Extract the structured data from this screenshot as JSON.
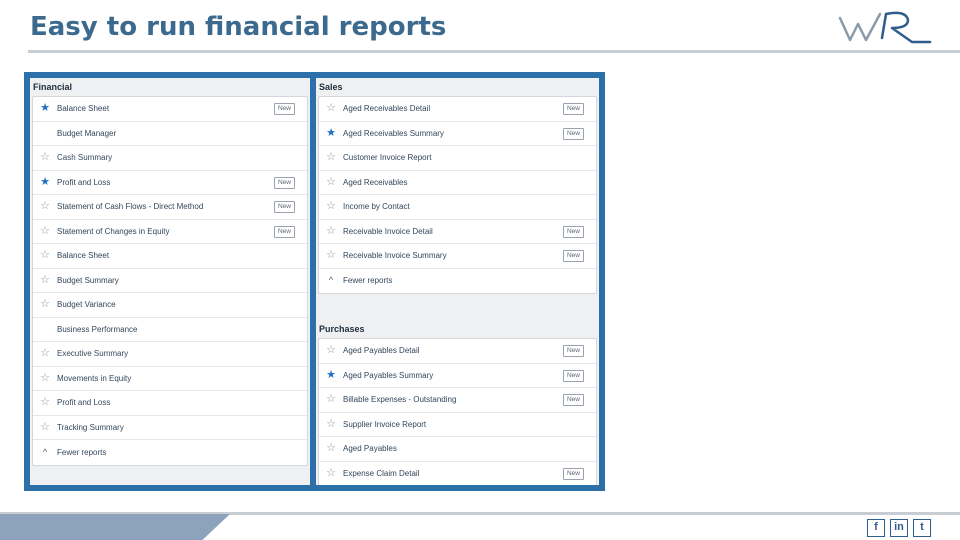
{
  "slide": {
    "title": "Easy to run financial reports"
  },
  "financial": {
    "heading": "Financial",
    "rows": [
      {
        "label": "Balance Sheet",
        "star": "filled",
        "new": "New"
      },
      {
        "label": "Budget Manager",
        "star": "none",
        "new": ""
      },
      {
        "label": "Cash Summary",
        "star": "outline",
        "new": ""
      },
      {
        "label": "Profit and Loss",
        "star": "filled",
        "new": "New"
      },
      {
        "label": "Statement of Cash Flows - Direct Method",
        "star": "outline",
        "new": "New"
      },
      {
        "label": "Statement of Changes in Equity",
        "star": "outline",
        "new": "New"
      },
      {
        "label": "Balance Sheet",
        "star": "outline",
        "new": ""
      },
      {
        "label": "Budget Summary",
        "star": "outline",
        "new": ""
      },
      {
        "label": "Budget Variance",
        "star": "outline",
        "new": ""
      },
      {
        "label": "Business Performance",
        "star": "none",
        "new": ""
      },
      {
        "label": "Executive Summary",
        "star": "outline",
        "new": ""
      },
      {
        "label": "Movements in Equity",
        "star": "outline",
        "new": ""
      },
      {
        "label": "Profit and Loss",
        "star": "outline",
        "new": ""
      },
      {
        "label": "Tracking Summary",
        "star": "outline",
        "new": ""
      },
      {
        "label": "Fewer reports",
        "star": "chevron",
        "new": ""
      }
    ]
  },
  "sales": {
    "heading": "Sales",
    "rows": [
      {
        "label": "Aged Receivables Detail",
        "star": "outline",
        "new": "New"
      },
      {
        "label": "Aged Receivables Summary",
        "star": "filled",
        "new": "New"
      },
      {
        "label": "Customer Invoice Report",
        "star": "outline",
        "new": ""
      },
      {
        "label": "Aged Receivables",
        "star": "outline",
        "new": ""
      },
      {
        "label": "Income by Contact",
        "star": "outline",
        "new": ""
      },
      {
        "label": "Receivable Invoice Detail",
        "star": "outline",
        "new": "New"
      },
      {
        "label": "Receivable Invoice Summary",
        "star": "outline",
        "new": "New"
      },
      {
        "label": "Fewer reports",
        "star": "chevron",
        "new": ""
      }
    ]
  },
  "purchases": {
    "heading": "Purchases",
    "rows": [
      {
        "label": "Aged Payables Detail",
        "star": "outline",
        "new": "New"
      },
      {
        "label": "Aged Payables Summary",
        "star": "filled",
        "new": "New"
      },
      {
        "label": "Billable Expenses - Outstanding",
        "star": "outline",
        "new": "New"
      },
      {
        "label": "Supplier Invoice Report",
        "star": "outline",
        "new": ""
      },
      {
        "label": "Aged Payables",
        "star": "outline",
        "new": ""
      },
      {
        "label": "Expense Claim Detail",
        "star": "outline",
        "new": "New"
      }
    ]
  },
  "icons": {
    "star_filled": "★",
    "star_outline": "☆",
    "chevron_up": "^"
  },
  "social": {
    "facebook": "f",
    "linkedin": "in",
    "twitter": "t"
  },
  "colors": {
    "title": "#3b6a8e",
    "frame": "#2d6fa8",
    "star_active": "#1f6fc4"
  }
}
